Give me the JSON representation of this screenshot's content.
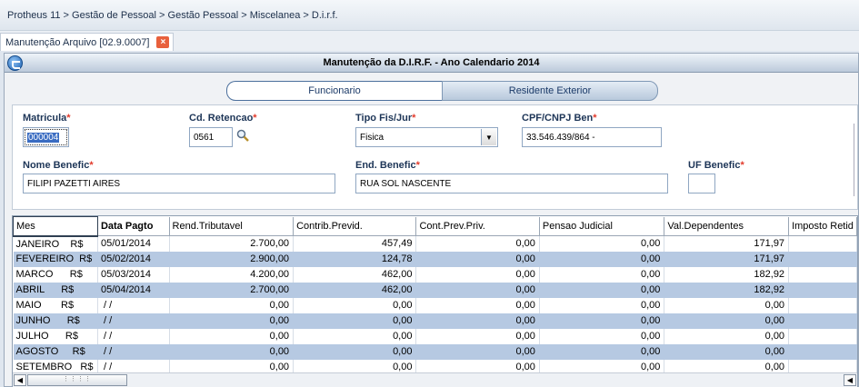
{
  "breadcrumb": "Protheus 11 > Gestão de Pessoal > Gestão Pessoal > Miscelanea > D.i.r.f.",
  "tab": {
    "label": "Manutenção Arquivo [02.9.0007]",
    "close": "×"
  },
  "window": {
    "title": "Manutenção da D.I.R.F. - Ano Calendario 2014"
  },
  "folders": {
    "active": "Funcionario",
    "inactive": "Residente Exterior"
  },
  "form": {
    "matricula": {
      "label": "Matricula",
      "value": "000004"
    },
    "cd_retencao": {
      "label": "Cd. Retencao",
      "value": "0561"
    },
    "tipo_fis_jur": {
      "label": "Tipo Fis/Jur",
      "value": "Fisica"
    },
    "cpf_cnpj": {
      "label": "CPF/CNPJ Ben",
      "value": "33.546.439/864 -"
    },
    "nome_benefic": {
      "label": "Nome Benefic",
      "value": "FILIPI PAZETTI AIRES"
    },
    "end_benefic": {
      "label": "End. Benefic",
      "value": "RUA SOL NASCENTE"
    },
    "uf_benefic": {
      "label": "UF Benefic",
      "value": ""
    },
    "required_mark": "*"
  },
  "grid": {
    "columns": [
      "Mes",
      "Data Pagto",
      "Rend.Tributavel",
      "Contrib.Previd.",
      "Cont.Prev.Priv.",
      "Pensao Judicial",
      "Val.Dependentes",
      "Imposto Retid"
    ],
    "rows": [
      [
        "JANEIRO    R$",
        "05/01/2014",
        "2.700,00",
        "457,49",
        "0,00",
        "0,00",
        "171,97",
        ""
      ],
      [
        "FEVEREIRO  R$",
        "05/02/2014",
        "2.900,00",
        "124,78",
        "0,00",
        "0,00",
        "171,97",
        ""
      ],
      [
        "MARCO      R$",
        "05/03/2014",
        "4.200,00",
        "462,00",
        "0,00",
        "0,00",
        "182,92",
        ""
      ],
      [
        "ABRIL      R$",
        "05/04/2014",
        "2.700,00",
        "462,00",
        "0,00",
        "0,00",
        "182,92",
        ""
      ],
      [
        "MAIO       R$",
        " / /",
        "0,00",
        "0,00",
        "0,00",
        "0,00",
        "0,00",
        ""
      ],
      [
        "JUNHO      R$",
        " / /",
        "0,00",
        "0,00",
        "0,00",
        "0,00",
        "0,00",
        ""
      ],
      [
        "JULHO      R$",
        " / /",
        "0,00",
        "0,00",
        "0,00",
        "0,00",
        "0,00",
        ""
      ],
      [
        "AGOSTO     R$",
        " / /",
        "0,00",
        "0,00",
        "0,00",
        "0,00",
        "0,00",
        ""
      ],
      [
        "SETEMBRO   R$",
        " / /",
        "0,00",
        "0,00",
        "0,00",
        "0,00",
        "0,00",
        ""
      ]
    ]
  },
  "icons": {
    "search": "search-icon",
    "dropdown": "chevron-down-icon",
    "window": "protheus-logo-icon"
  },
  "colors": {
    "alt_row": "#b6c9e2",
    "required": "#e23b2c",
    "selection": "#3a6cc2",
    "tab_close": "#e8603c"
  }
}
